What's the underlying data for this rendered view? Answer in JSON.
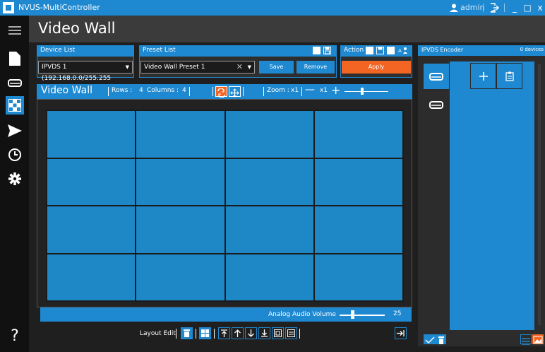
{
  "app": {
    "title": "NVUS-MultiController",
    "user": "admin"
  },
  "page": {
    "title": "Video Wall"
  },
  "device_list": {
    "header": "Device List",
    "selected": "IPVDS 1 (192.168.0.0/255.255"
  },
  "preset_list": {
    "header": "Preset List",
    "selected": "Video Wall Preset 1",
    "save_label": "Save",
    "remove_label": "Remove"
  },
  "action": {
    "header": "Action",
    "apply_label": "Apply"
  },
  "video_wall": {
    "title": "Video Wall",
    "rows_label": "Rows :",
    "rows_value": "4",
    "columns_label": "Columns :",
    "columns_value": "4",
    "zoom_label": "Zoom :",
    "zoom_value": "x1",
    "zoom_value2": "x1",
    "grid_rows": 4,
    "grid_columns": 4
  },
  "audio": {
    "label": "Analog Audio Volume",
    "value": "25",
    "level_fraction": 0.25
  },
  "layout_edit": {
    "label": "Layout Edit"
  },
  "encoder": {
    "header": "IPVDS Encoder",
    "count": "0 devices"
  },
  "colors": {
    "accent": "#1e88d0",
    "apply": "#f26522",
    "cell": "#1e88c7",
    "background": "#1f1f1f"
  }
}
